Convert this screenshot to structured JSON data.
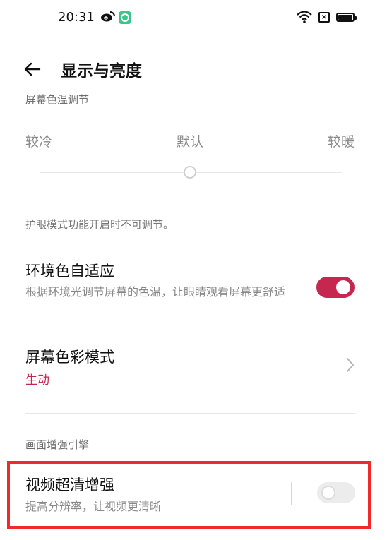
{
  "status_bar": {
    "time": "20:31",
    "icons": [
      "weibo-icon",
      "app-notification-icon",
      "wifi-icon",
      "sim-off-icon",
      "battery-icon"
    ],
    "sim_glyph": "×"
  },
  "header": {
    "back_icon": "arrow-left-icon",
    "title": "显示与亮度"
  },
  "color_temperature": {
    "label": "屏幕色温调节",
    "options": [
      "较冷",
      "默认",
      "较暖"
    ],
    "selected": "默认",
    "note": "护眼模式功能开启时不可调节。"
  },
  "ambient_adaptive": {
    "title": "环境色自适应",
    "subtitle": "根据环境光调节屏幕的色温，让眼睛观看屏幕更舒适",
    "enabled": true
  },
  "screen_color_mode": {
    "title": "屏幕色彩模式",
    "value": "生动"
  },
  "picture_enhance": {
    "label": "画面增强引擎",
    "video_enhance": {
      "title": "视频超清增强",
      "subtitle": "提高分辨率，让视频更清晰",
      "enabled": false
    }
  },
  "colors": {
    "accent": "#c5274e",
    "highlight_border": "#ee2a2a"
  }
}
